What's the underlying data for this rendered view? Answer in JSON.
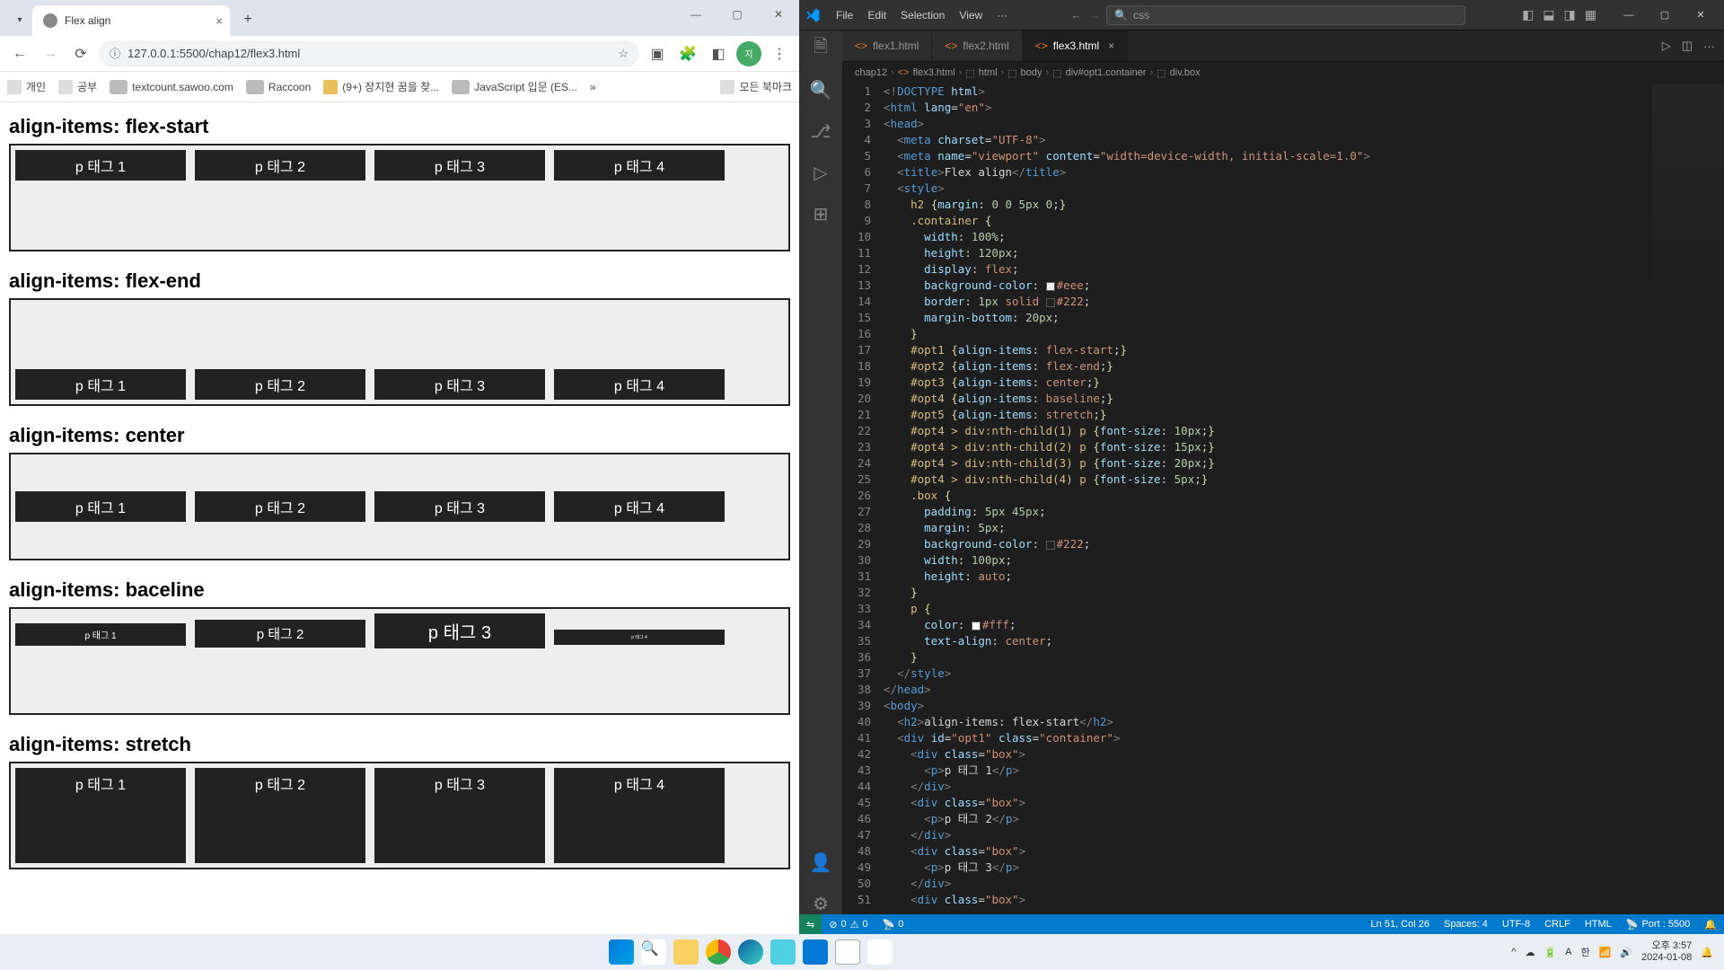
{
  "chrome": {
    "tab_title": "Flex align",
    "url": "127.0.0.1:5500/chap12/flex3.html",
    "bookmarks": [
      "개인",
      "공부",
      "textcount.sawoo.com",
      "Raccoon",
      "(9+) 장지현 꿈을 찾...",
      "JavaScript 입문 (ES...",
      "»",
      "모든 북마크"
    ]
  },
  "page": {
    "sections": [
      {
        "h": "align-items: flex-start",
        "cls": "opt1"
      },
      {
        "h": "align-items: flex-end",
        "cls": "opt2"
      },
      {
        "h": "align-items: center",
        "cls": "opt3"
      },
      {
        "h": "align-items: baceline",
        "cls": "opt4"
      },
      {
        "h": "align-items: stretch",
        "cls": "opt5"
      }
    ],
    "boxes": [
      "p 태그 1",
      "p 태그 2",
      "p 태그 3",
      "p 태그 4"
    ]
  },
  "vscode": {
    "menu": [
      "File",
      "Edit",
      "Selection",
      "View",
      "···"
    ],
    "search_placeholder": "css",
    "tabs": [
      {
        "label": "flex1.html",
        "active": false
      },
      {
        "label": "flex2.html",
        "active": false
      },
      {
        "label": "flex3.html",
        "active": true
      }
    ],
    "breadcrumb": [
      "chap12",
      "flex3.html",
      "html",
      "body",
      "div#opt1.container",
      "div.box"
    ],
    "status": {
      "errors": "0",
      "warnings": "0",
      "port": "0",
      "line_col": "Ln 51, Col 26",
      "spaces": "Spaces: 4",
      "encoding": "UTF-8",
      "eol": "CRLF",
      "lang": "HTML",
      "live": "Port : 5500"
    }
  },
  "taskbar": {
    "time": "오후 3:57",
    "date": "2024-01-08"
  }
}
